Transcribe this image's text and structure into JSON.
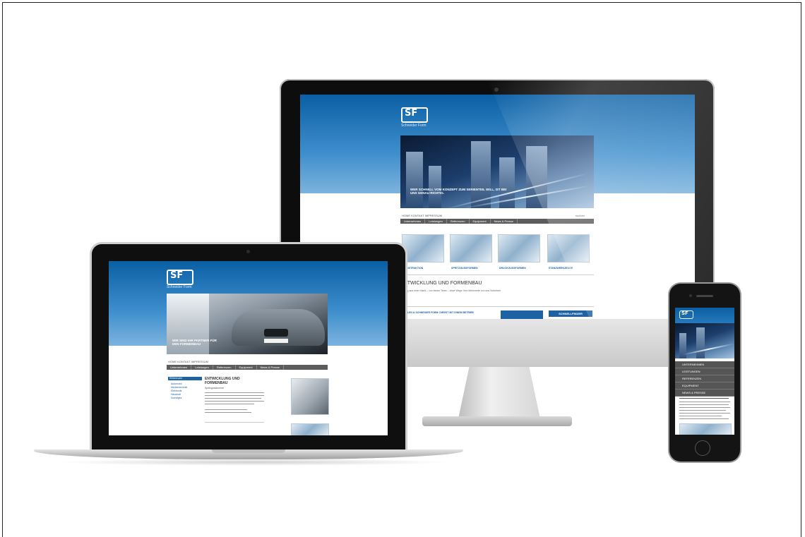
{
  "monitor_site": {
    "logo": "SF",
    "logo_sub": "Schneider Form",
    "hero_caption": "Wer Schnell vom Konzept zum Serienteil will, ist bei uns genau richtig.",
    "top_links": "HOME  KONTAKT  IMPRESSUM",
    "search": "suchen",
    "nav": [
      "Unternehmen",
      "Leistungen",
      "Referenzen",
      "Equipment",
      "News & Presse"
    ],
    "thumbs": [
      "Konstruktion",
      "Spritzgussformen",
      "Druckgussformen",
      "Stanzwerkzeuge"
    ],
    "section_title": "ENTWICKLUNG UND FORMENBAU",
    "section_text": "Lösung aus einer Hand – von einem Team – ohne Wege. Ihre Mehrwerte von uns Schreiner",
    "banner_text": "SCHALEN & SCHNEIDER FORM: DIREKT MIT EINEM BETRIEB",
    "quick_button": "SCHNELLFINDER"
  },
  "laptop_site": {
    "logo": "SF",
    "logo_sub": "Schneider Form",
    "hero_caption": "Wir sind Ihr Partner für den Formenbau",
    "top_links": "HOME  KONTAKT  IMPRESSUM",
    "nav": [
      "Unternehmen",
      "Leistungen",
      "Referenzen",
      "Equipment",
      "News & Presse"
    ],
    "sidebar_title": "Referenzen",
    "sidebar_items": [
      "Automobil",
      "Medizintechnik",
      "Elektronik",
      "Haushalt",
      "Sonstiges"
    ],
    "article_title": "Entwicklung und Formenbau",
    "article_sub": "Spritzgussformen"
  },
  "phone_site": {
    "logo": "SF",
    "menu": [
      "Unternehmen",
      "Leistungen",
      "Referenzen",
      "Equipment",
      "News & Presse"
    ]
  }
}
